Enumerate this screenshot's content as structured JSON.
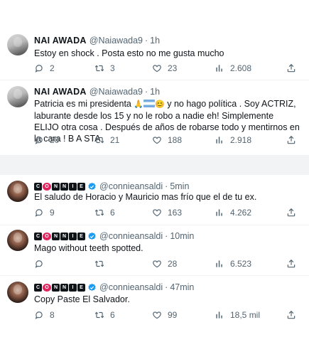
{
  "tweets": [
    {
      "author_name": "NAI AWADA",
      "handle": "@Naiawada9",
      "separator": "·",
      "time": "1h",
      "text": "Estoy en shock . Posta esto no me gusta mucho",
      "replies": "2",
      "retweets": "3",
      "likes": "23",
      "views": "2.608"
    },
    {
      "author_name": "NAI AWADA",
      "handle": "@Naiawada9",
      "separator": "·",
      "time": "1h",
      "text_part1": "Patricia es mi presidenta",
      "text_emoji_1": "🙏",
      "text_emoji_3": "😊",
      "text_part2": "y no hago política . Soy ACTRIZ, laburante desde los 15 y no le robo a nadie eh! Simplemente ELIJO otra cosa . Después de años de robarse todo y mentirnos en la cara ! B A STA",
      "replies": "20",
      "retweets": "21",
      "likes": "188",
      "views": "2.918"
    },
    {
      "author_name_letters": [
        "C",
        "O",
        "N",
        "N",
        "I",
        "E"
      ],
      "handle": "@connieansaldi",
      "separator": "·",
      "time": "5min",
      "text": "El saludo de Horacio y  Mauricio mas frío que el de tu ex.",
      "replies": "9",
      "retweets": "6",
      "likes": "163",
      "views": "4.262"
    },
    {
      "author_name_letters": [
        "C",
        "O",
        "N",
        "N",
        "I",
        "E"
      ],
      "handle": "@connieansaldi",
      "separator": "·",
      "time": "10min",
      "text": "Mago without teeth spotted.",
      "replies": "",
      "retweets": "",
      "likes": "28",
      "views": "6.523"
    },
    {
      "author_name_letters": [
        "C",
        "O",
        "N",
        "N",
        "I",
        "E"
      ],
      "handle": "@connieansaldi",
      "separator": "·",
      "time": "47min",
      "text": "Copy Paste El Salvador.",
      "replies": "8",
      "retweets": "6",
      "likes": "99",
      "views": "18,5 mil"
    }
  ],
  "icons": {
    "reply": "reply-icon",
    "retweet": "retweet-icon",
    "like": "heart-icon",
    "views": "views-icon",
    "share": "share-icon",
    "verified": "verified-badge-icon"
  },
  "colors": {
    "text": "#0f1419",
    "muted": "#536471",
    "verified": "#1d9bf0",
    "separator_band": "#f2f3f4"
  }
}
